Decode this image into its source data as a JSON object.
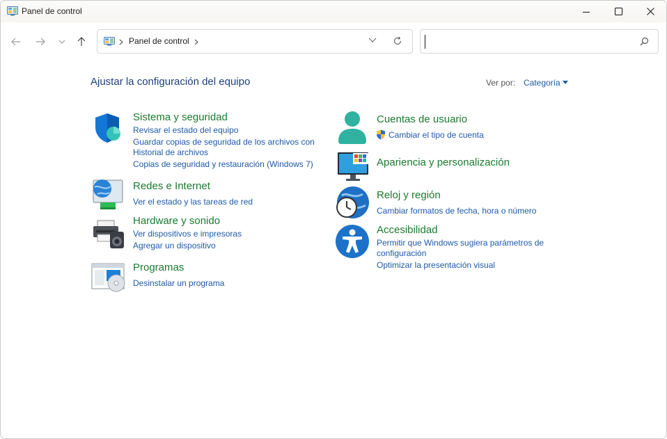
{
  "window": {
    "title": "Panel de control",
    "colors": {
      "heading": "#1e3f7a",
      "category": "#1b7a2e",
      "link": "#1e5aa8"
    }
  },
  "nav": {
    "address_text": "Panel de control",
    "search_placeholder": ""
  },
  "main": {
    "heading": "Ajustar la configuración del equipo",
    "view_by_label": "Ver por:",
    "view_by_value": "Categoría"
  },
  "categories": {
    "sistema": {
      "title": "Sistema y seguridad",
      "icon": "shield-icon",
      "links": [
        "Revisar el estado del equipo",
        "Guardar copias de seguridad de los archivos con",
        "Historial de archivos",
        "Copias de seguridad y restauración (Windows 7)"
      ]
    },
    "redes": {
      "title": "Redes e Internet",
      "icon": "network-globe-icon",
      "links": [
        "Ver el estado y las tareas de red"
      ]
    },
    "hardware": {
      "title": "Hardware y sonido",
      "icon": "printer-speaker-icon",
      "links": [
        "Ver dispositivos e impresoras",
        "Agregar un dispositivo"
      ]
    },
    "programas": {
      "title": "Programas",
      "icon": "programs-disc-icon",
      "links": [
        "Desinstalar un programa"
      ]
    },
    "cuentas": {
      "title": "Cuentas de usuario",
      "icon": "user-icon",
      "links": [
        "Cambiar el tipo de cuenta"
      ]
    },
    "apariencia": {
      "title": "Apariencia y personalización",
      "icon": "monitor-personalization-icon",
      "links": []
    },
    "reloj": {
      "title": "Reloj y región",
      "icon": "clock-globe-icon",
      "links": [
        "Cambiar formatos de fecha, hora o número"
      ]
    },
    "accesibilidad": {
      "title": "Accesibilidad",
      "icon": "accessibility-icon",
      "links": [
        "Permitir que Windows sugiera parámetros de",
        "configuración",
        "Optimizar la presentación visual"
      ]
    }
  }
}
